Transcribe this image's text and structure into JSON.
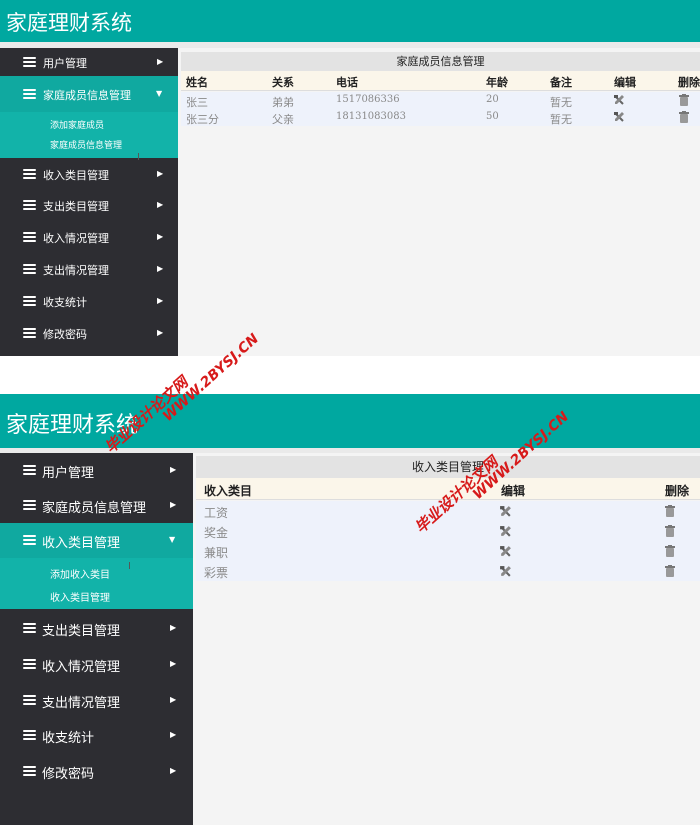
{
  "app_title": "家庭理财系统",
  "panel1": {
    "menu": [
      {
        "label": "用户管理",
        "expanded": false
      },
      {
        "label": "家庭成员信息管理",
        "expanded": true
      },
      {
        "label": "收入类目管理",
        "expanded": false
      },
      {
        "label": "支出类目管理",
        "expanded": false
      },
      {
        "label": "收入情况管理",
        "expanded": false
      },
      {
        "label": "支出情况管理",
        "expanded": false
      },
      {
        "label": "收支统计",
        "expanded": false
      },
      {
        "label": "修改密码",
        "expanded": false
      }
    ],
    "submenu": [
      "添加家庭成员",
      "家庭成员信息管理"
    ],
    "content_title": "家庭成员信息管理",
    "columns": [
      "姓名",
      "关系",
      "电话",
      "年龄",
      "备注",
      "编辑",
      "删除"
    ],
    "rows": [
      {
        "name": "张三",
        "relation": "弟弟",
        "phone": "1517086336",
        "age": "20",
        "note": "暂无"
      },
      {
        "name": "张三分",
        "relation": "父亲",
        "phone": "18131083083",
        "age": "50",
        "note": "暂无"
      }
    ]
  },
  "panel2": {
    "menu": [
      {
        "label": "用户管理",
        "expanded": false
      },
      {
        "label": "家庭成员信息管理",
        "expanded": false
      },
      {
        "label": "收入类目管理",
        "expanded": true
      },
      {
        "label": "支出类目管理",
        "expanded": false
      },
      {
        "label": "收入情况管理",
        "expanded": false
      },
      {
        "label": "支出情况管理",
        "expanded": false
      },
      {
        "label": "收支统计",
        "expanded": false
      },
      {
        "label": "修改密码",
        "expanded": false
      }
    ],
    "submenu": [
      "添加收入类目",
      "收入类目管理"
    ],
    "content_title": "收入类目管理",
    "columns": [
      "收入类目",
      "编辑",
      "删除"
    ],
    "rows": [
      {
        "category": "工资"
      },
      {
        "category": "奖金"
      },
      {
        "category": "兼职"
      },
      {
        "category": "彩票"
      }
    ]
  },
  "watermark": {
    "line1": "毕业设计论文网",
    "line2": "WWW.2BYSJ.CN",
    "color": "#d71a1a"
  },
  "colors": {
    "header": "#00a8a0",
    "sidebar": "#2d2d32",
    "active": "#10a9a0",
    "submenu": "#12b3a9"
  },
  "icons": {
    "menu": "stack-icon",
    "chevron": "chevron-right-icon",
    "chevron_open": "chevron-down-icon",
    "edit": "edit-tool-icon",
    "delete": "trash-icon"
  }
}
